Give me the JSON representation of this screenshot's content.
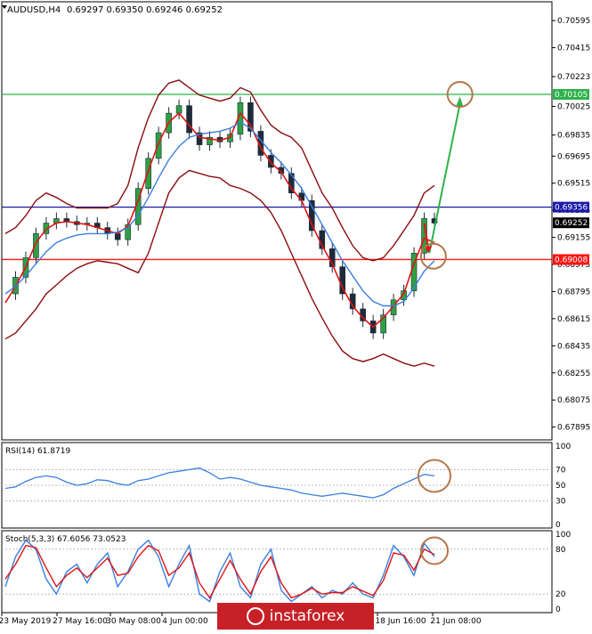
{
  "chart_data": {
    "type": "line",
    "instrument": {
      "symbol": "AUDUSD,H4",
      "ohlc": "0.69297 0.69350 0.69246 0.69252"
    },
    "price_ticks": [
      "0.70595",
      "0.70415",
      "0.70223",
      "0.70025",
      "0.69835",
      "0.69695",
      "0.69515",
      "0.69335",
      "0.69155",
      "0.68975",
      "0.68795",
      "0.68615",
      "0.68435",
      "0.68255",
      "0.68075",
      "0.67895"
    ],
    "ylim": [
      0.6781,
      0.7072
    ],
    "levels": [
      {
        "label": "0.70105",
        "price": 0.70105,
        "color": "#2eb24a"
      },
      {
        "label": "0.69356",
        "price": 0.69356,
        "color": "#1a1aa8"
      },
      {
        "label": "0.69252",
        "price": 0.69252,
        "color": "#000000"
      },
      {
        "label": "0.69008",
        "price": 0.69008,
        "color": "#ff1414"
      }
    ],
    "x_labels": [
      "23 May 2019",
      "27 May 16:00",
      "30 May 08:00",
      "4 Jun 00:00",
      "18 Jun 16:00",
      "21 Jun 08:00"
    ],
    "series": [
      {
        "name": "price",
        "color": "#2c3e50",
        "values": [
          0.6878,
          0.6889,
          0.6902,
          0.6918,
          0.6925,
          0.6928,
          0.6926,
          0.6924,
          0.6925,
          0.6922,
          0.6918,
          0.6914,
          0.6924,
          0.6948,
          0.6968,
          0.6985,
          0.6998,
          0.7003,
          0.6985,
          0.6977,
          0.6982,
          0.6979,
          0.6984,
          0.7005,
          0.6986,
          0.697,
          0.6962,
          0.6958,
          0.6945,
          0.694,
          0.692,
          0.6908,
          0.6896,
          0.6878,
          0.6868,
          0.686,
          0.6852,
          0.6864,
          0.6874,
          0.688,
          0.6905,
          0.6928,
          0.6925
        ]
      },
      {
        "name": "fast-ma",
        "color": "#e01414",
        "values": [
          0.6872,
          0.6883,
          0.6896,
          0.6912,
          0.6921,
          0.6925,
          0.6926,
          0.6925,
          0.6924,
          0.6922,
          0.692,
          0.6918,
          0.6923,
          0.694,
          0.696,
          0.6978,
          0.6992,
          0.6998,
          0.699,
          0.6982,
          0.6981,
          0.698,
          0.6982,
          0.6998,
          0.699,
          0.6975,
          0.6965,
          0.6959,
          0.6948,
          0.694,
          0.6924,
          0.691,
          0.6898,
          0.6882,
          0.687,
          0.6862,
          0.6856,
          0.6862,
          0.687,
          0.6878,
          0.6898,
          0.6915,
          0.6912
        ]
      },
      {
        "name": "slow-ma",
        "color": "#3a7fe0",
        "values": [
          0.6878,
          0.6883,
          0.689,
          0.6898,
          0.6906,
          0.6912,
          0.6915,
          0.6917,
          0.6918,
          0.6918,
          0.6918,
          0.6919,
          0.6922,
          0.693,
          0.6942,
          0.6955,
          0.6967,
          0.6976,
          0.6982,
          0.6984,
          0.6985,
          0.6986,
          0.6988,
          0.6992,
          0.6988,
          0.698,
          0.6972,
          0.6965,
          0.6957,
          0.6948,
          0.6936,
          0.6924,
          0.6912,
          0.69,
          0.689,
          0.688,
          0.6873,
          0.687,
          0.687,
          0.6873,
          0.6882,
          0.6893,
          0.69
        ]
      },
      {
        "name": "upper-band",
        "color": "#8b0d0d",
        "values": [
          0.6918,
          0.6922,
          0.693,
          0.694,
          0.6945,
          0.6942,
          0.6938,
          0.6935,
          0.6935,
          0.6935,
          0.6935,
          0.6938,
          0.695,
          0.6975,
          0.6995,
          0.701,
          0.7018,
          0.702,
          0.7015,
          0.701,
          0.7008,
          0.7006,
          0.7008,
          0.7015,
          0.7012,
          0.7,
          0.699,
          0.6985,
          0.6982,
          0.6975,
          0.696,
          0.6945,
          0.6935,
          0.6922,
          0.691,
          0.6902,
          0.69,
          0.6902,
          0.691,
          0.692,
          0.693,
          0.6945,
          0.695
        ]
      },
      {
        "name": "lower-band",
        "color": "#8b0d0d",
        "values": [
          0.6848,
          0.6852,
          0.686,
          0.6868,
          0.6878,
          0.6884,
          0.689,
          0.6895,
          0.6898,
          0.69,
          0.6899,
          0.6898,
          0.6895,
          0.6892,
          0.6905,
          0.6925,
          0.6945,
          0.6955,
          0.696,
          0.6958,
          0.6956,
          0.6955,
          0.695,
          0.6948,
          0.6945,
          0.694,
          0.6932,
          0.692,
          0.6905,
          0.689,
          0.6875,
          0.6862,
          0.685,
          0.684,
          0.6835,
          0.6833,
          0.6835,
          0.6838,
          0.6835,
          0.6832,
          0.683,
          0.6832,
          0.683
        ]
      }
    ],
    "annotations": {
      "up_arrow": {
        "from": [
          41.5,
          0.6905
        ],
        "to": [
          44.5,
          0.7009
        ]
      },
      "down_arrow": {
        "from": [
          41.0,
          0.6925
        ],
        "to": [
          41.4,
          0.6905
        ]
      },
      "circles": [
        {
          "x": 44.5,
          "price": 0.70105
        },
        {
          "x": 41.9,
          "price": 0.6903
        }
      ]
    },
    "rsi": {
      "label": "RSI(14) 61.8719",
      "ticks": [
        "100",
        "70",
        "50",
        "30",
        "0"
      ],
      "levels": [
        70,
        50,
        30
      ],
      "ylim": [
        0,
        100
      ],
      "values": [
        46,
        48,
        55,
        60,
        62,
        60,
        54,
        50,
        52,
        57,
        56,
        52,
        50,
        56,
        58,
        62,
        66,
        68,
        70,
        72,
        66,
        58,
        60,
        58,
        54,
        50,
        48,
        46,
        44,
        40,
        38,
        36,
        38,
        40,
        38,
        36,
        34,
        38,
        46,
        52,
        58,
        64,
        62
      ],
      "circle": {
        "x": 42,
        "value": 62
      }
    },
    "stoch": {
      "label": "Stoch(5,3,3) 67.6056 73.0523",
      "ticks": [
        "100",
        "80",
        "20",
        "0"
      ],
      "levels": [
        80,
        20
      ],
      "ylim": [
        0,
        100
      ],
      "k": [
        30,
        70,
        92,
        80,
        40,
        20,
        50,
        60,
        35,
        60,
        75,
        30,
        50,
        80,
        92,
        70,
        30,
        60,
        85,
        20,
        10,
        50,
        75,
        30,
        15,
        60,
        80,
        25,
        10,
        20,
        30,
        15,
        25,
        20,
        35,
        20,
        15,
        45,
        85,
        70,
        45,
        88,
        70
      ],
      "d": [
        40,
        60,
        85,
        82,
        55,
        30,
        45,
        55,
        42,
        55,
        68,
        45,
        48,
        70,
        85,
        78,
        45,
        55,
        75,
        35,
        15,
        40,
        65,
        40,
        20,
        50,
        70,
        35,
        15,
        20,
        28,
        20,
        22,
        22,
        30,
        24,
        18,
        38,
        75,
        72,
        52,
        80,
        73
      ],
      "circle": {
        "x": 42,
        "value": 78
      }
    }
  },
  "watermark": {
    "text": "instaforex",
    "color": "#c72026"
  }
}
